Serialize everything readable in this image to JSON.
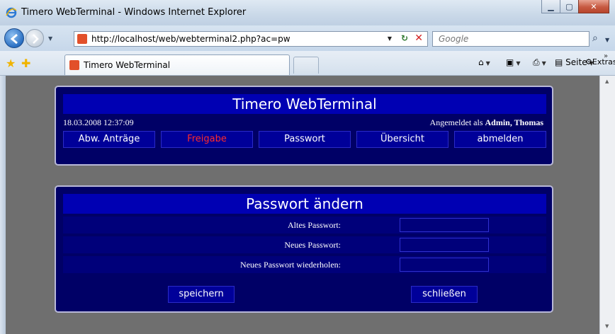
{
  "browser": {
    "window_title": "Timero WebTerminal - Windows Internet Explorer",
    "address_url": "http://localhost/web/webterminal2.php?ac=pw",
    "search_placeholder": "Google",
    "tab_title": "Timero WebTerminal",
    "commands": {
      "page_label": "Seite",
      "tools_label": "Extras"
    }
  },
  "header": {
    "title": "Timero WebTerminal",
    "datetime": "18.03.2008 12:37:09",
    "logged_in_prefix": "Angemeldet als ",
    "logged_in_user": "Admin, Thomas"
  },
  "menu": {
    "items": [
      {
        "label": "Abw. Anträge"
      },
      {
        "label": "Freigabe"
      },
      {
        "label": "Passwort"
      },
      {
        "label": "Übersicht"
      },
      {
        "label": "abmelden"
      }
    ]
  },
  "password_form": {
    "title": "Passwort ändern",
    "fields": [
      {
        "label": "Altes Passwort:",
        "value": ""
      },
      {
        "label": "Neues Passwort:",
        "value": ""
      },
      {
        "label": "Neues Passwort wiederholen:",
        "value": ""
      }
    ],
    "save_label": "speichern",
    "close_label": "schließen"
  },
  "colors": {
    "panel_bg": "#000066",
    "header_bar": "#0000b3",
    "active_menu_text": "#ff2a2a",
    "page_bg": "#6f6f6f"
  }
}
